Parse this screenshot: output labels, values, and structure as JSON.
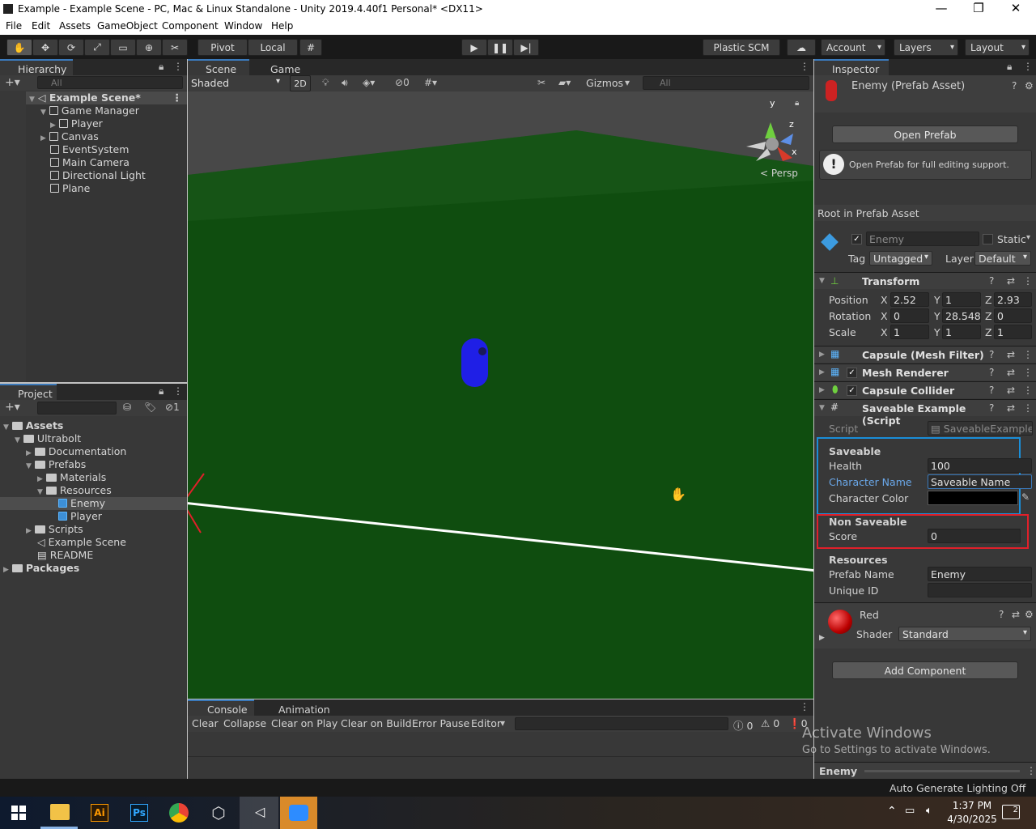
{
  "window": {
    "title": "Example - Example Scene - PC, Mac & Linux Standalone - Unity 2019.4.40f1 Personal* <DX11>",
    "min": "—",
    "max": "❐",
    "close": "✕"
  },
  "menu": [
    "File",
    "Edit",
    "Assets",
    "GameObject",
    "Component",
    "Window",
    "Help"
  ],
  "toolbar": {
    "pivot": "Pivot",
    "local": "Local",
    "plastic": "Plastic SCM",
    "account": "Account",
    "layers": "Layers",
    "layout": "Layout"
  },
  "hierarchy": {
    "tab": "Hierarchy",
    "search_placeholder": "All",
    "scene": "Example Scene*",
    "items": [
      "Game Manager",
      "Player",
      "Canvas",
      "EventSystem",
      "Main Camera",
      "Directional Light",
      "Plane"
    ]
  },
  "project": {
    "tab": "Project",
    "badge": "1",
    "items": [
      "Assets",
      "Ultrabolt",
      "Documentation",
      "Prefabs",
      "Materials",
      "Resources",
      "Enemy",
      "Player",
      "Scripts",
      "Example Scene",
      "README",
      "Packages"
    ]
  },
  "scene": {
    "tab_scene": "Scene",
    "tab_game": "Game",
    "shading": "Shaded",
    "mode2d": "2D",
    "hidden_count": "0",
    "gizmos": "Gizmos",
    "search_placeholder": "All",
    "persp": "Persp",
    "axis_y": "y",
    "axis_z": "z",
    "axis_x": "x"
  },
  "console": {
    "tab_console": "Console",
    "tab_animation": "Animation",
    "clear": "Clear",
    "collapse": "Collapse",
    "clear_on_play": "Clear on Play",
    "clear_on_build": "Clear on Build",
    "error_pause": "Error Pause",
    "editor": "Editor",
    "info": "0",
    "warn": "0",
    "err": "0"
  },
  "inspector": {
    "tab": "Inspector",
    "asset_title": "Enemy (Prefab Asset)",
    "open_prefab": "Open Prefab",
    "note": "Open Prefab for full editing support.",
    "root": "Root in Prefab Asset",
    "name": "Enemy",
    "static": "Static",
    "tag_label": "Tag",
    "tag": "Untagged",
    "layer_label": "Layer",
    "layer": "Default",
    "transform": {
      "title": "Transform",
      "position": {
        "label": "Position",
        "x": "2.52",
        "y": "1",
        "z": "2.93"
      },
      "rotation": {
        "label": "Rotation",
        "x": "0",
        "y": "28.548",
        "z": "0"
      },
      "scale": {
        "label": "Scale",
        "x": "1",
        "y": "1",
        "z": "1"
      }
    },
    "components": [
      "Capsule (Mesh Filter)",
      "Mesh Renderer",
      "Capsule Collider",
      "Saveable Example (Script"
    ],
    "script_label": "Script",
    "script_value": "SaveableExample",
    "saveable": {
      "title": "Saveable",
      "health_label": "Health",
      "health": "100",
      "name_label": "Character Name",
      "name": "Saveable Name",
      "color_label": "Character Color",
      "color": "#000000"
    },
    "non_saveable": {
      "title": "Non Saveable",
      "score_label": "Score",
      "score": "0"
    },
    "resources": {
      "title": "Resources",
      "prefab_label": "Prefab Name",
      "prefab": "Enemy",
      "uid_label": "Unique ID",
      "uid": ""
    },
    "material": {
      "name": "Red",
      "shader_label": "Shader",
      "shader": "Standard"
    },
    "add_component": "Add Component",
    "footer": "Enemy"
  },
  "watermark": {
    "line1": "Activate Windows",
    "line2": "Go to Settings to activate Windows."
  },
  "status": "Auto Generate Lighting Off",
  "taskbar": {
    "time": "1:37 PM",
    "date": "4/30/2025",
    "notif": "2"
  },
  "colors": {
    "accent": "#3a79bb",
    "ground": "#0f4d0f",
    "capsule": "#1f1fe6",
    "highlight_blue": "#1a8ed8",
    "highlight_red": "#e0202a"
  }
}
